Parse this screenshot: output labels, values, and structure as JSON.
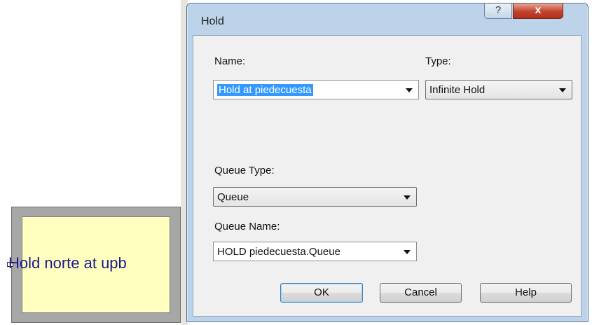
{
  "canvas": {
    "module_label": "Hold norte at upb"
  },
  "dialog": {
    "title": "Hold",
    "help_glyph": "?",
    "close_glyph": "x",
    "name": {
      "label": "Name:",
      "value": "Hold at piedecuesta"
    },
    "type": {
      "label": "Type:",
      "value": "Infinite Hold"
    },
    "queue_type": {
      "label": "Queue Type:",
      "value": "Queue"
    },
    "queue_name": {
      "label": "Queue Name:",
      "value": "HOLD piedecuesta.Queue"
    },
    "buttons": {
      "ok": "OK",
      "cancel": "Cancel",
      "help": "Help"
    }
  }
}
